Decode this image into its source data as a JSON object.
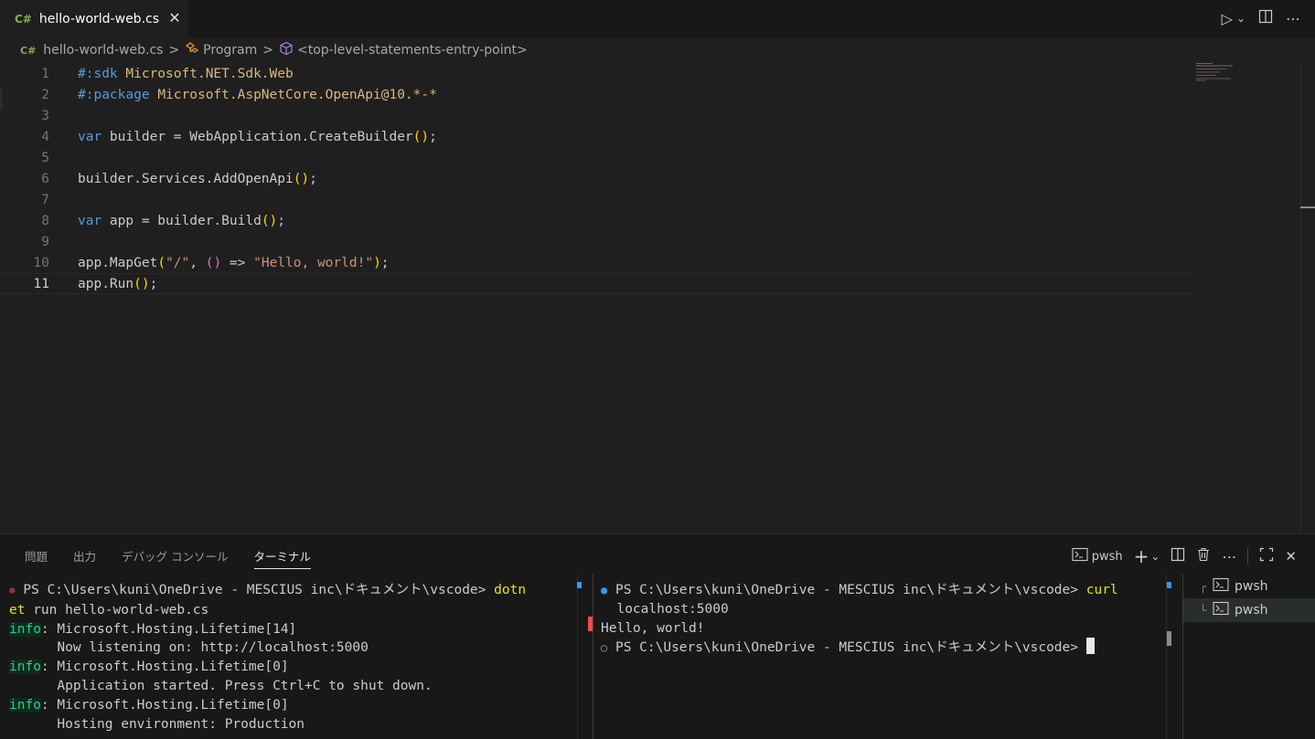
{
  "tab": {
    "lang_badge": "C#",
    "filename": "hello-world-web.cs",
    "close": "✕"
  },
  "editor_actions": {
    "run": "▷",
    "run_dropdown": "⌄",
    "split": "split-editor-icon",
    "more": "⋯"
  },
  "breadcrumb": {
    "lang_badge": "C#",
    "items": [
      "hello-world-web.cs",
      "Program",
      "<top-level-statements-entry-point>"
    ],
    "sep": ">"
  },
  "code_lines": [
    {
      "n": "1"
    },
    {
      "n": "2"
    },
    {
      "n": "3"
    },
    {
      "n": "4"
    },
    {
      "n": "5"
    },
    {
      "n": "6"
    },
    {
      "n": "7"
    },
    {
      "n": "8"
    },
    {
      "n": "9"
    },
    {
      "n": "10"
    },
    {
      "n": "11"
    }
  ],
  "code": {
    "l1a": "#:sdk",
    "l1b": "Microsoft.NET.Sdk.Web",
    "l2a": "#:package",
    "l2b": "Microsoft.AspNetCore.OpenApi@10.*-*",
    "l4a": "var",
    "l4b": " builder = WebApplication.CreateBuilder",
    "l4c": "()",
    "l4d": ";",
    "l6a": "builder.Services.AddOpenApi",
    "l6b": "()",
    "l6c": ";",
    "l8a": "var",
    "l8b": " app = builder.Build",
    "l8c": "()",
    "l8d": ";",
    "l10a": "app.MapGet",
    "l10b": "(",
    "l10c": "\"/\"",
    "l10d": ", ",
    "l10e": "()",
    "l10f": " => ",
    "l10g": "\"Hello, world!\"",
    "l10h": ")",
    "l10i": ";",
    "l11a": "app.Run",
    "l11b": "()",
    "l11c": ";"
  },
  "panel": {
    "tabs": [
      "問題",
      "出力",
      "デバッグ コンソール",
      "ターミナル"
    ],
    "active_tab": "ターミナル",
    "shell_label": "pwsh",
    "actions": {
      "add": "+",
      "add_dropdown": "⌄",
      "split": "split-terminal-icon",
      "trash": "trash-icon",
      "more": "⋯",
      "maximize": "maximize-icon",
      "close": "✕"
    }
  },
  "terminal_left": {
    "l1_prompt": "PS C:\\Users\\kuni\\OneDrive - MESCIUS inc\\ドキュメント\\vscode> ",
    "l1_cmd": "dotn",
    "l2_cmd": "et",
    "l2_rest": " run hello-world-web.cs",
    "info": "info",
    "l3": ": Microsoft.Hosting.Lifetime[14]",
    "l4": "      Now listening on: http://localhost:5000",
    "l5": ": Microsoft.Hosting.Lifetime[0]",
    "l6": "      Application started. Press Ctrl+C to shut down.",
    "l7": ": Microsoft.Hosting.Lifetime[0]",
    "l8": "      Hosting environment: Production"
  },
  "terminal_right": {
    "l1_prompt": "PS C:\\Users\\kuni\\OneDrive - MESCIUS inc\\ドキュメント\\vscode> ",
    "l1_cmd": "curl",
    "l2": "localhost:5000",
    "l3": "Hello, world!",
    "l4_prompt": "PS C:\\Users\\kuni\\OneDrive - MESCIUS inc\\ドキュメント\\vscode> "
  },
  "terminal_list": [
    {
      "label": "pwsh",
      "tree": "┌"
    },
    {
      "label": "pwsh",
      "tree": "└"
    }
  ]
}
